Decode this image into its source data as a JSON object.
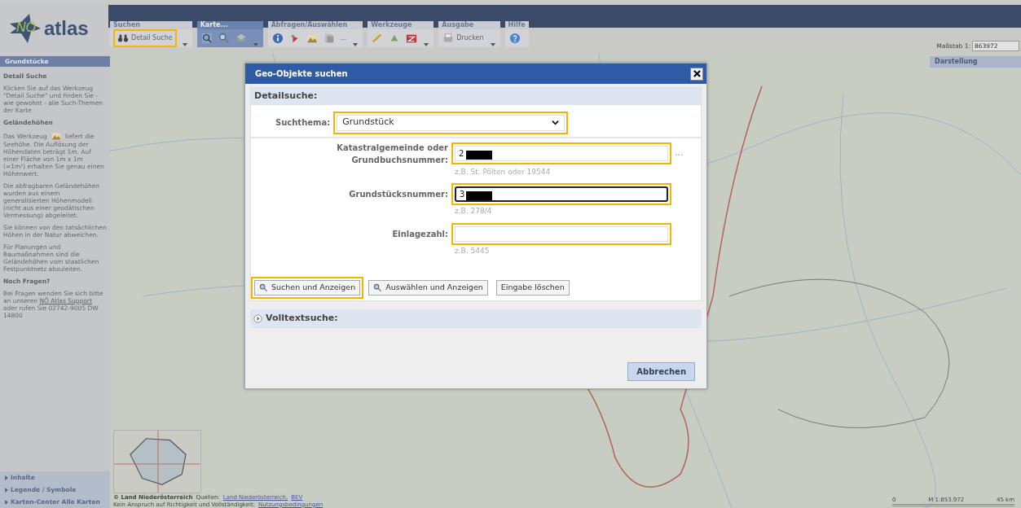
{
  "logo": {
    "prefix": "NÖ",
    "name": "atlas"
  },
  "toolbar": {
    "groups": [
      {
        "label": "Suchen",
        "active": false,
        "menu": true,
        "tools": [
          {
            "kind": "binoculars",
            "label": "Detail Suche",
            "highlighted": true
          }
        ]
      },
      {
        "label": "Karte...",
        "active": true,
        "menu": true,
        "tools": [
          {
            "kind": "zoom"
          },
          {
            "kind": "magnify"
          },
          {
            "kind": "layers"
          }
        ]
      },
      {
        "label": "Abfragen/Auswählen",
        "active": false,
        "menu": true,
        "tools": [
          {
            "kind": "info"
          },
          {
            "kind": "pin"
          },
          {
            "kind": "terrain"
          },
          {
            "kind": "select"
          },
          {
            "kind": "more",
            "label": "..."
          }
        ]
      },
      {
        "label": "Werkzeuge",
        "active": false,
        "menu": true,
        "tools": [
          {
            "kind": "measure"
          },
          {
            "kind": "draw"
          },
          {
            "kind": "erase"
          }
        ]
      },
      {
        "label": "Ausgabe",
        "active": false,
        "menu": true,
        "tools": [
          {
            "kind": "print",
            "label": "Drucken"
          }
        ]
      },
      {
        "label": "Hilfe",
        "active": false,
        "menu": false,
        "tools": [
          {
            "kind": "help"
          }
        ]
      }
    ]
  },
  "scale": {
    "label": "Maßstab 1:",
    "value": "863972"
  },
  "right_panel": {
    "title": "Darstellung"
  },
  "sidebar": {
    "title": "Grundstücke",
    "sections": [
      {
        "heading": "Detail Suche",
        "paragraphs": [
          {
            "kind": "text",
            "text": "Klicken Sie auf das Werkzeug \"Detail Suche\" und finden Sie - wie gewohnt - alle Such-Themen der Karte"
          }
        ]
      },
      {
        "heading": "Geländehöhen",
        "paragraphs": [
          {
            "kind": "with_icon",
            "before": "Das Werkzeug",
            "after": "liefert die",
            "rest": "Seehöhe. Die Auflösung der Höhendaten beträgt 1m. Auf einer Fläche von 1m x 1m (=1m²) erhalten Sie genau einen Höhenwert."
          },
          {
            "kind": "text",
            "text": "Die abfragbaren Geländehöhen wurden aus einem generalisierten Höhenmodell (nicht aus einer geodätischen Vermessung) abgeleitet."
          },
          {
            "kind": "text",
            "text": "Sie können von den tatsächlichen Höhen in der Natur abweichen."
          },
          {
            "kind": "text",
            "text": "Für Planungen und Baumaßnahmen sind die Geländehöhen vom staatlichen Festpunktnetz abzuleiten."
          }
        ]
      },
      {
        "heading": "Noch Fragen?",
        "paragraphs": [
          {
            "kind": "with_link",
            "before": "Bei Fragen wenden Sie sich bitte an unseren",
            "link": "NÖ Atlas Support",
            "after": "oder rufen Sie 02742-9005 DW 14800"
          }
        ]
      }
    ],
    "footer_items": [
      "Inhalte",
      "Legende / Symbole",
      "Karten-Center Alle Karten"
    ]
  },
  "attribution": {
    "owner": "© Land Niederösterreich",
    "sources_label": "Quellen:",
    "sources": [
      "Land Niederösterreich,",
      "BEV"
    ],
    "disclaimer": "Kein Anspruch auf Richtigkeit und Vollständigkeit:",
    "disclaimer_link": "Nutzungsbedingungen"
  },
  "scalebar": {
    "start": "0",
    "ratio": "M 1:853.972",
    "end": "45 km"
  },
  "dialog": {
    "title": "Geo-Objekte suchen",
    "section": "Detailsuche:",
    "topic": {
      "label": "Suchthema:",
      "value": "Grundstück",
      "highlighted": true
    },
    "fields": [
      {
        "label": "Katastralgemeinde oder Grundbuchsnummer:",
        "value": "2",
        "redacted": true,
        "hint": "z.B. St. Pölten oder 19544",
        "focused": false,
        "browse": "...",
        "highlighted": true
      },
      {
        "label": "Grundstücksnummer:",
        "value": "3",
        "redacted": true,
        "hint": "z.B. 278/4",
        "focused": true,
        "highlighted": true
      },
      {
        "label": "Einlagezahl:",
        "redacted": false,
        "hint": "z.B. 5445",
        "focused": false,
        "highlighted": true
      }
    ],
    "buttons": [
      {
        "label": "Suchen und Anzeigen",
        "icon": true,
        "highlighted": true
      },
      {
        "label": "Auswählen und Anzeigen",
        "icon": true,
        "highlighted": false
      },
      {
        "label": "Eingabe löschen",
        "icon": false,
        "highlighted": false
      }
    ],
    "fulltext": {
      "label": "Volltextsuche:",
      "expanded": false
    },
    "cancel": "Abbrechen"
  }
}
